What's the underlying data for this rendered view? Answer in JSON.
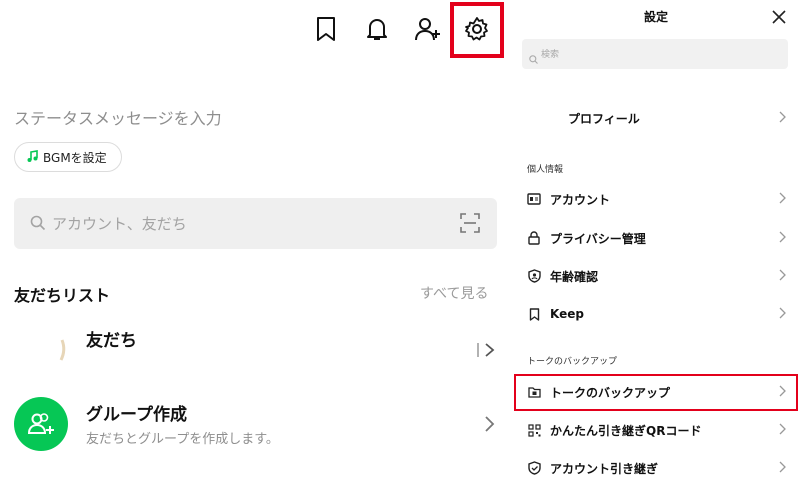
{
  "left": {
    "status_placeholder": "ステータスメッセージを入力",
    "bgm_label": "BGMを設定",
    "search_placeholder": "アカウント、友だち",
    "friends_list_title": "友だちリスト",
    "see_all": "すべて見る",
    "friends_item": "友だち",
    "group_create_title": "グループ作成",
    "group_create_subtitle": "友だちとグループを作成します。"
  },
  "settings": {
    "title": "設定",
    "search_placeholder": "検索",
    "profile": "プロフィール",
    "section_personal": "個人情報",
    "items_personal": [
      "アカウント",
      "プライバシー管理",
      "年齢確認",
      "Keep"
    ],
    "section_backup": "トークのバックアップ",
    "items_backup": [
      "トークのバックアップ",
      "かんたん引き継ぎQRコード",
      "アカウント引き継ぎ"
    ]
  },
  "colors": {
    "highlight": "#e3001b",
    "line_green": "#06c755"
  },
  "icons": [
    "bookmark-icon",
    "bell-icon",
    "add-friend-icon",
    "gear-icon",
    "search-icon",
    "scan-icon",
    "music-note-icon",
    "group-add-icon",
    "close-icon",
    "account-card-icon",
    "lock-icon",
    "age-shield-icon",
    "keep-bookmark-icon",
    "backup-folder-icon",
    "qr-code-icon",
    "transfer-shield-icon"
  ]
}
